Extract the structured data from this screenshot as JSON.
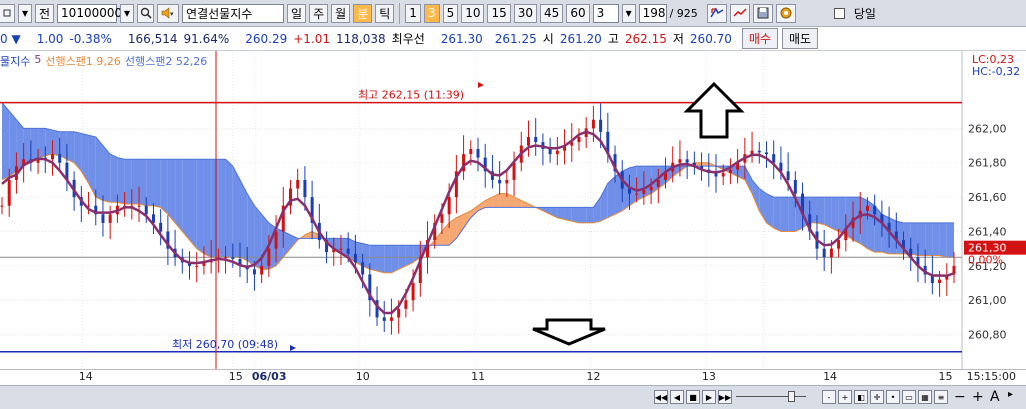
{
  "toolbar": {
    "leading_icon": "square-glyph-icon",
    "type_label": "전",
    "code": "10100000",
    "name": "연결선물지수",
    "periods": [
      "일",
      "주",
      "월"
    ],
    "minute_label": "분",
    "tick_label": "틱",
    "intervals": [
      "1",
      "3",
      "5",
      "10",
      "15",
      "30",
      "45",
      "60"
    ],
    "active_interval": "3",
    "interval_select": "3",
    "count": "198",
    "total": "/ 925",
    "today_label": "당일"
  },
  "quote": {
    "arrow_value": "0 ▼",
    "change": "1.00",
    "change_pct": "-0.38%",
    "volume": "166,514",
    "ratio": "91.64%",
    "price2": "260.29",
    "diff2": "+1.01",
    "oi": "118,038",
    "best_label": "최우선",
    "best_sell": "261.30",
    "best_buy": "261.25",
    "open_label": "시",
    "open": "261.20",
    "high_label": "고",
    "high": "262.15",
    "low_label": "저",
    "low": "260.70",
    "buy_button": "매수",
    "sell_button": "매도"
  },
  "legend": {
    "item1": "물지수",
    "item1_val": "5",
    "span1": "선행스팬1 9,26",
    "span2": "선행스팬2 52,26"
  },
  "chart_data": {
    "type": "candlestick",
    "ylim": [
      260.6,
      262.45
    ],
    "yticks": [
      "262,00",
      "261,80",
      "261,60",
      "261,40",
      "261,20",
      "261,00",
      "260,80"
    ],
    "lc": "LC:0,23",
    "hc": "HC:-0,32",
    "high_annotation": "최고 262,15 (11:39)",
    "low_annotation": "최저 260,70 (09:48)",
    "high_line": 262.15,
    "low_line": 260.7,
    "base_line": 261.25,
    "current_price": "261,30",
    "current_pct": "0,00%",
    "x_ticks": [
      {
        "x": 14,
        "label": "14"
      },
      {
        "x": 40,
        "label": "15"
      },
      {
        "x": 44,
        "label": "06/03",
        "date": true
      },
      {
        "x": 62,
        "label": "10"
      },
      {
        "x": 82,
        "label": "11"
      },
      {
        "x": 102,
        "label": "12"
      },
      {
        "x": 122,
        "label": "13"
      },
      {
        "x": 143,
        "label": "14"
      },
      {
        "x": 163,
        "label": "15"
      }
    ],
    "time_label": "15:15:00",
    "close": [
      261.55,
      261.7,
      261.78,
      261.82,
      261.8,
      261.83,
      261.82,
      261.85,
      261.8,
      261.7,
      261.6,
      261.55,
      261.55,
      261.5,
      261.45,
      261.5,
      261.55,
      261.55,
      261.55,
      261.55,
      261.5,
      261.45,
      261.4,
      261.3,
      261.25,
      261.22,
      261.2,
      261.2,
      261.22,
      261.24,
      261.25,
      261.25,
      261.24,
      261.2,
      261.18,
      261.15,
      261.2,
      261.3,
      261.4,
      261.55,
      261.65,
      261.7,
      261.6,
      261.45,
      261.35,
      261.28,
      261.3,
      261.3,
      261.27,
      261.22,
      261.15,
      261.0,
      260.9,
      260.88,
      260.9,
      260.95,
      261.0,
      261.1,
      261.25,
      261.35,
      261.45,
      261.5,
      261.6,
      261.75,
      261.85,
      261.88,
      261.83,
      261.75,
      261.7,
      261.68,
      261.7,
      261.8,
      261.9,
      261.95,
      261.92,
      261.88,
      261.85,
      261.87,
      261.9,
      261.92,
      261.95,
      262.0,
      262.05,
      261.98,
      261.85,
      261.75,
      261.65,
      261.62,
      261.62,
      261.64,
      261.66,
      261.7,
      261.75,
      261.8,
      261.82,
      261.8,
      261.78,
      261.76,
      261.74,
      261.72,
      261.74,
      261.76,
      261.8,
      261.85,
      261.87,
      261.86,
      261.85,
      261.8,
      261.75,
      261.7,
      261.62,
      261.5,
      261.4,
      261.3,
      261.25,
      261.3,
      261.35,
      261.42,
      261.48,
      261.52,
      261.55,
      261.5,
      261.45,
      261.4,
      261.35,
      261.3,
      261.25,
      261.2,
      261.15,
      261.1,
      261.12,
      261.15,
      261.2
    ],
    "span1": [
      261.7,
      261.72,
      261.75,
      261.78,
      261.8,
      261.82,
      261.84,
      261.85,
      261.84,
      261.82,
      261.8,
      261.75,
      261.68,
      261.6,
      261.58,
      261.57,
      261.57,
      261.56,
      261.56,
      261.56,
      261.55,
      261.55,
      261.54,
      261.5,
      261.45,
      261.4,
      261.35,
      261.3,
      261.27,
      261.25,
      261.25,
      261.25,
      261.25,
      261.25,
      261.23,
      261.2,
      261.18,
      261.18,
      261.2,
      261.25,
      261.3,
      261.35,
      261.38,
      261.4,
      261.38,
      261.35,
      261.3,
      261.27,
      261.25,
      261.22,
      261.2,
      261.18,
      261.17,
      261.16,
      261.16,
      261.18,
      261.2,
      261.22,
      261.25,
      261.3,
      261.35,
      261.4,
      261.45,
      261.48,
      261.5,
      261.52,
      261.55,
      261.58,
      261.6,
      261.62,
      261.62,
      261.6,
      261.58,
      261.56,
      261.54,
      261.52,
      261.5,
      261.48,
      261.47,
      261.46,
      261.45,
      261.45,
      261.45,
      261.46,
      261.48,
      261.5,
      261.52,
      261.55,
      261.58,
      261.6,
      261.62,
      261.65,
      261.68,
      261.72,
      261.75,
      261.78,
      261.8,
      261.8,
      261.8,
      261.78,
      261.76,
      261.74,
      261.72,
      261.7,
      261.62,
      261.52,
      261.45,
      261.42,
      261.4,
      261.4,
      261.4,
      261.42,
      261.45,
      261.45,
      261.44,
      261.42,
      261.4,
      261.38,
      261.35,
      261.33,
      261.3,
      261.28,
      261.28,
      261.27,
      261.27,
      261.27,
      261.27,
      261.26,
      261.26,
      261.26,
      261.26,
      261.25,
      261.25
    ],
    "span2": [
      262.15,
      262.1,
      262.05,
      262.0,
      262.0,
      262.0,
      262.0,
      261.99,
      261.98,
      261.98,
      261.98,
      261.97,
      261.96,
      261.95,
      261.9,
      261.85,
      261.83,
      261.82,
      261.82,
      261.82,
      261.82,
      261.82,
      261.82,
      261.82,
      261.82,
      261.82,
      261.82,
      261.82,
      261.82,
      261.82,
      261.82,
      261.82,
      261.78,
      261.7,
      261.62,
      261.55,
      261.5,
      261.45,
      261.42,
      261.4,
      261.38,
      261.36,
      261.36,
      261.36,
      261.36,
      261.36,
      261.36,
      261.36,
      261.36,
      261.34,
      261.33,
      261.32,
      261.32,
      261.32,
      261.32,
      261.32,
      261.32,
      261.32,
      261.32,
      261.32,
      261.32,
      261.32,
      261.32,
      261.36,
      261.42,
      261.48,
      261.52,
      261.54,
      261.54,
      261.54,
      261.54,
      261.54,
      261.54,
      261.54,
      261.54,
      261.54,
      261.54,
      261.54,
      261.54,
      261.54,
      261.54,
      261.54,
      261.54,
      261.6,
      261.68,
      261.72,
      261.75,
      261.77,
      261.78,
      261.78,
      261.78,
      261.78,
      261.78,
      261.78,
      261.78,
      261.78,
      261.78,
      261.78,
      261.78,
      261.78,
      261.78,
      261.78,
      261.78,
      261.78,
      261.7,
      261.65,
      261.62,
      261.6,
      261.6,
      261.6,
      261.6,
      261.6,
      261.6,
      261.6,
      261.6,
      261.6,
      261.6,
      261.6,
      261.6,
      261.6,
      261.58,
      261.55,
      261.5,
      261.48,
      261.46,
      261.45,
      261.45,
      261.45,
      261.45,
      261.45,
      261.45,
      261.45,
      261.45
    ]
  }
}
